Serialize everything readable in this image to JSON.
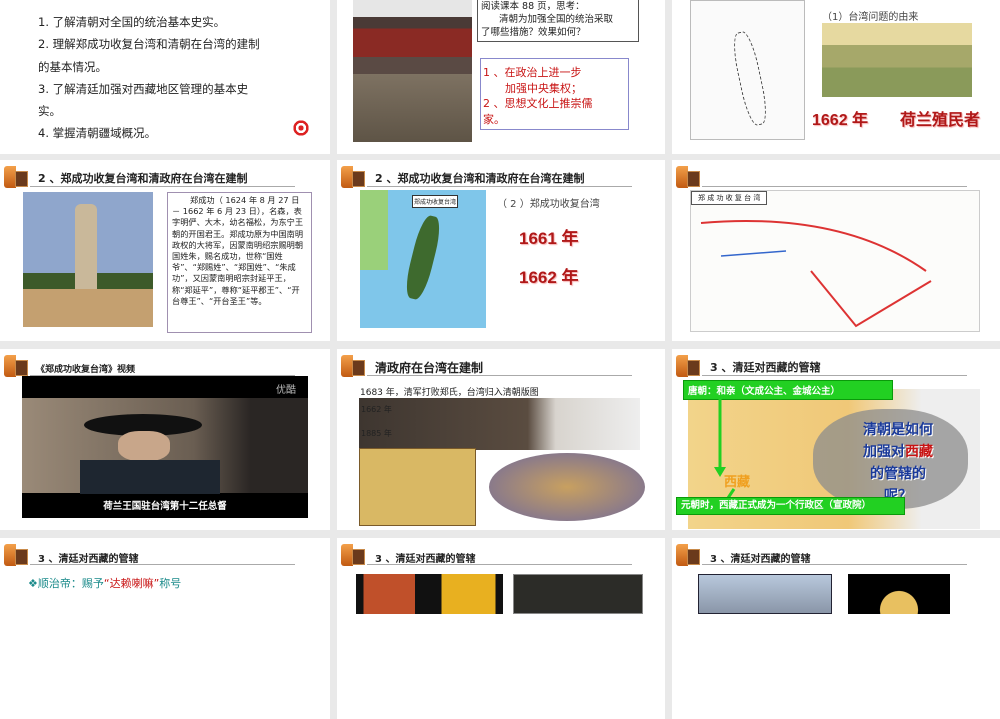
{
  "slides": [
    {
      "objectives": [
        "1. 了解清朝对全国的统治基本史实。",
        "2. 理解郑成功收复台湾和清朝在台湾的建制",
        "的基本情况。",
        "3. 了解清廷加强对西藏地区管理的基本史",
        "实。",
        "4. 掌握清朝疆域概况。"
      ],
      "icon": "target-icon"
    },
    {
      "question": [
        "阅读课本 88 页，思考：",
        "清朝为加强全国的统治采取",
        "了哪些措施？效果如何？"
      ],
      "answer": [
        "1 、在政治上进一步",
        "加强中央集权；",
        "2 、思想文化上推崇儒",
        "家。"
      ]
    },
    {
      "subtitle": "（1）台湾问题的由来",
      "year": "1662 年",
      "who": "荷兰殖民者"
    },
    {
      "title": "2 、郑成功收复台湾和清政府在台湾在建制",
      "bio": "郑成功（ 1624 年 8 月 27 日－ 1662 年 6 月 23 日），名森，表字明俨、大木，幼名福松，为东宁王朝的开国君王。郑成功原为中国南明政权的大将军，因蒙南明绍宗赐明朝国姓朱，赐名成功，世称“国姓爷”、“郑赐姓”、“郑国姓”、“朱成功”，又因蒙南明昭宗封延平王，称“郑延平”，尊称“延平郡王”、“开台尊王”、“开台圣王”等。"
    },
    {
      "title": "2 、郑成功收复台湾和清政府在台湾在建制",
      "subtitle": "（ 2 ）郑成功收复台湾",
      "year1": "1661 年",
      "year2": "1662 年",
      "map_label": "郑成功收复台湾"
    },
    {
      "title": "",
      "map_label": "郑 成 功 收 复 台 湾"
    },
    {
      "title": "《郑成功收复台湾》视频",
      "watermark": "优酷",
      "caption": "荷兰王国驻台湾第十二任总督"
    },
    {
      "title": "清政府在台湾在建制",
      "line1": "1683 年，清军打败郑氏，台湾归入清朝版图",
      "line2": "1662 年",
      "line3": "1885 年"
    },
    {
      "title": "3 、清廷对西藏的管辖",
      "tang": "唐朝：和亲（文成公主、金城公主）",
      "yuan": "元朝时，西藏正式成为一个行政区（宣政院）",
      "q1": "清朝是如何",
      "q2a": "加强对",
      "q2b": "西藏",
      "q3": "的管辖的",
      "q4": "呢？",
      "tibet": "西藏"
    },
    {
      "title": "3 、清廷对西藏的管辖",
      "item_a": "❖顺治帝：赐予",
      "item_b": "“达赖喇嘛”",
      "item_c": "称号"
    },
    {
      "title": "3 、清廷对西藏的管辖"
    },
    {
      "title": "3 、清廷对西藏的管辖"
    }
  ],
  "colors": {
    "red": "#c81414",
    "green": "#22d022",
    "bg": "#e9e9e9"
  }
}
